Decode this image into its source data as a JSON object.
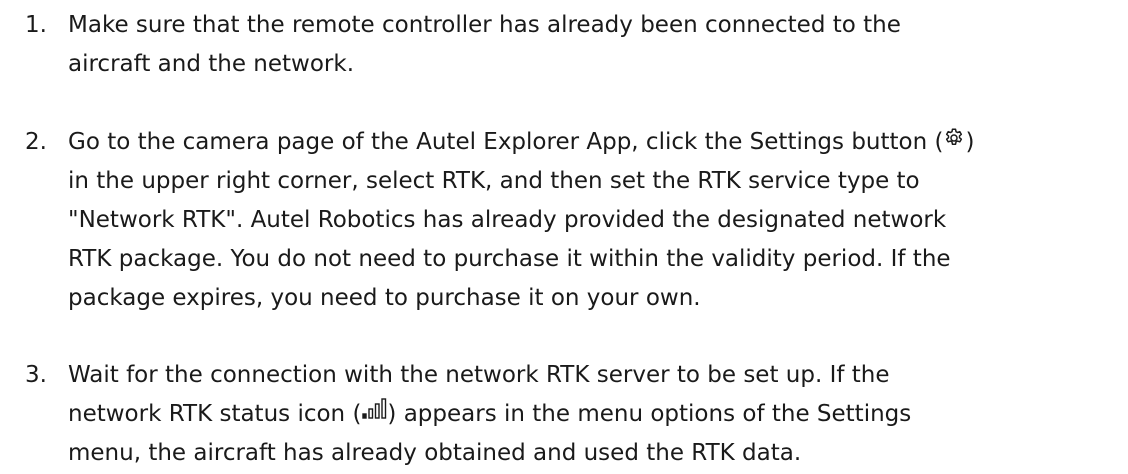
{
  "steps": [
    {
      "number": "1.",
      "lines": [
        "Make sure that the remote controller has already been connected to the",
        "aircraft and the network."
      ]
    },
    {
      "number": "2.",
      "line1_before_icon": "Go to the camera page of the Autel Explorer App, click the Settings button (",
      "line1_after_icon": ")",
      "lines": [
        "in the upper right corner, select RTK, and then set the RTK service type to",
        "\"Network RTK\". Autel Robotics has already provided the designated network",
        "RTK package. You do not need to purchase it within the validity period. If the",
        "package expires, you need to purchase it on your own."
      ],
      "icon": "gear-icon"
    },
    {
      "number": "3.",
      "lines": [
        "Wait for the connection with the network RTK server to be set up. If the"
      ],
      "line2_before_icon": "network RTK status icon (",
      "line2_after_icon": ") appears in the menu options of the Settings",
      "line3": "menu, the aircraft has already obtained and used the RTK data.",
      "icon": "signal-icon"
    }
  ]
}
